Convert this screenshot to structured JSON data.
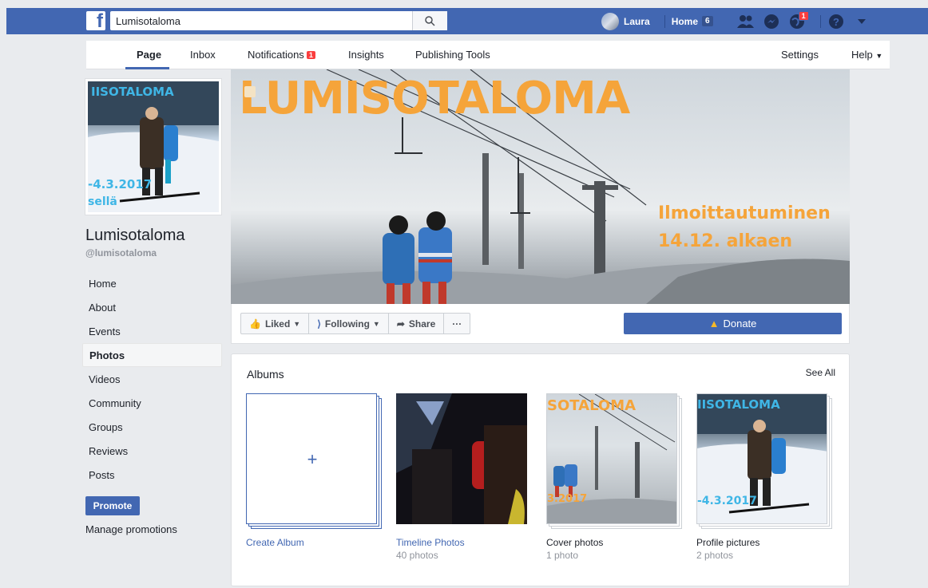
{
  "topbar": {
    "search_value": "Lumisotaloma",
    "user_name": "Laura",
    "home_label": "Home",
    "home_count": "6",
    "notif_count": "1"
  },
  "pagenav": {
    "items": [
      "Page",
      "Inbox",
      "Notifications",
      "Insights",
      "Publishing Tools"
    ],
    "notifications_badge": "1",
    "settings": "Settings",
    "help": "Help"
  },
  "profile": {
    "name": "Lumisotaloma",
    "handle": "@lumisotaloma",
    "img_title": "IISOTALOMA",
    "img_date": "-4.3.2017",
    "img_sub": "sellä"
  },
  "leftnav": {
    "items": [
      "Home",
      "About",
      "Events",
      "Photos",
      "Videos",
      "Community",
      "Groups",
      "Reviews",
      "Posts"
    ],
    "active": "Photos",
    "promote": "Promote",
    "manage": "Manage promotions"
  },
  "cover": {
    "title": "LUMISOTALOMA",
    "line1": "Ilmoittautuminen",
    "line2": "14.12. alkaen"
  },
  "actions": {
    "liked": "Liked",
    "following": "Following",
    "share": "Share",
    "more": "···",
    "donate": "Donate"
  },
  "albums": {
    "title": "Albums",
    "see_all": "See All",
    "items": [
      {
        "name": "Create Album",
        "count": ""
      },
      {
        "name": "Timeline Photos",
        "count": "40 photos"
      },
      {
        "name": "Cover photos",
        "count": "1 photo"
      },
      {
        "name": "Profile pictures",
        "count": "2 photos"
      }
    ],
    "cover_thumb_title": "SOTALOMA",
    "cover_thumb_date": "3.2017",
    "profile_thumb_title": "IISOTALOMA",
    "profile_thumb_date": "-4.3.2017"
  },
  "colors": {
    "brand": "#4267b2",
    "accent_orange": "#f5a43a",
    "badge_red": "#fa3e3e"
  }
}
